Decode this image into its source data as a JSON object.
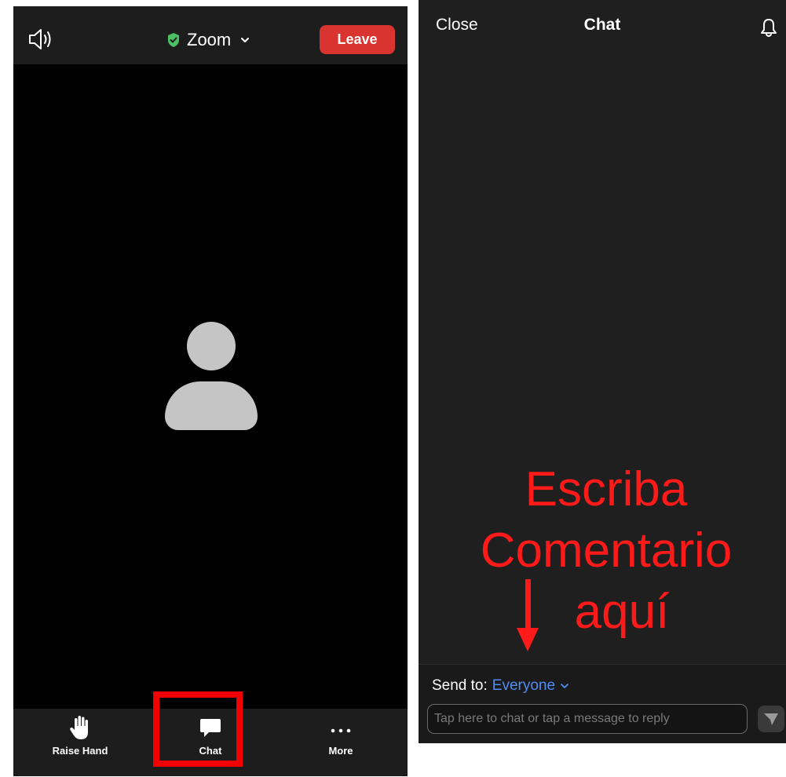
{
  "meeting": {
    "title": "Zoom",
    "leave_label": "Leave",
    "icons": {
      "speaker": "speaker-icon",
      "security": "shield-check-icon",
      "title_dropdown": "chevron-down-icon"
    },
    "toolbar": [
      {
        "label": "Raise Hand",
        "icon": "raised-hand-icon"
      },
      {
        "label": "Chat",
        "icon": "chat-bubble-icon"
      },
      {
        "label": "More",
        "icon": "ellipsis-icon"
      }
    ]
  },
  "chat": {
    "close_label": "Close",
    "title": "Chat",
    "annotation_lines": [
      "Escriba",
      "Comentario",
      "aquí"
    ],
    "send_to_label": "Send to:",
    "send_to_value": "Everyone",
    "input_placeholder": "Tap here to chat or tap a message to reply",
    "input_value": ""
  },
  "colors": {
    "leave": "#d9342f",
    "accent_blue": "#4f8ef7",
    "annotation_red": "#ff1a1a",
    "shield_green": "#4cc163"
  }
}
